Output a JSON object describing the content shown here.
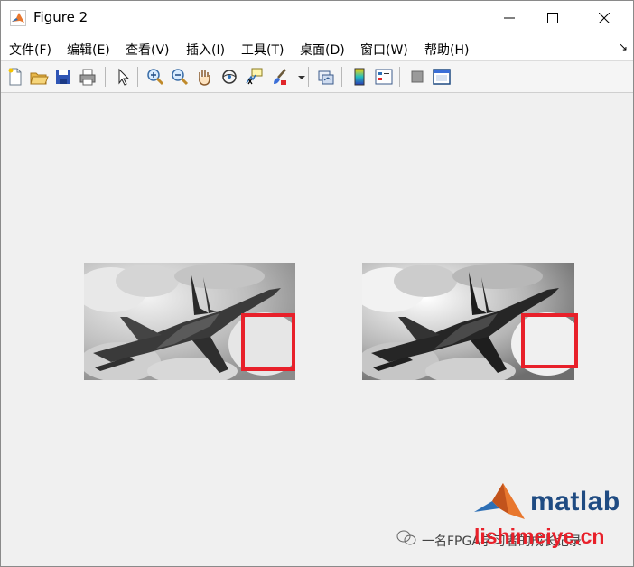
{
  "window": {
    "title": "Figure 2",
    "icon": "matlab-icon"
  },
  "menubar": {
    "items": [
      {
        "label": "文件(F)"
      },
      {
        "label": "编辑(E)"
      },
      {
        "label": "查看(V)"
      },
      {
        "label": "插入(I)"
      },
      {
        "label": "工具(T)"
      },
      {
        "label": "桌面(D)"
      },
      {
        "label": "窗口(W)"
      },
      {
        "label": "帮助(H)"
      }
    ],
    "overflow_icon": "dock-arrow-icon"
  },
  "toolbar": {
    "buttons": [
      "new-figure-icon",
      "open-file-icon",
      "save-icon",
      "print-icon",
      "select-arrow-icon",
      "zoom-in-icon",
      "zoom-out-icon",
      "pan-hand-icon",
      "rotate-3d-icon",
      "data-cursor-icon",
      "brush-icon",
      "brush-dropdown-icon",
      "link-plot-icon",
      "colorbar-icon",
      "legend-icon",
      "hide-plot-tools-icon",
      "show-plot-tools-icon"
    ]
  },
  "figure": {
    "images": [
      {
        "name": "left",
        "content": "grayscale fighter jet over clouds"
      },
      {
        "name": "right",
        "content": "enhanced grayscale fighter jet over clouds"
      }
    ],
    "highlight_color": "#e8202a"
  },
  "watermark": {
    "logo_text": "matlab",
    "site_text": "lishimeiye.cn",
    "author_text": "一名FPGA学习者的成长记录"
  }
}
